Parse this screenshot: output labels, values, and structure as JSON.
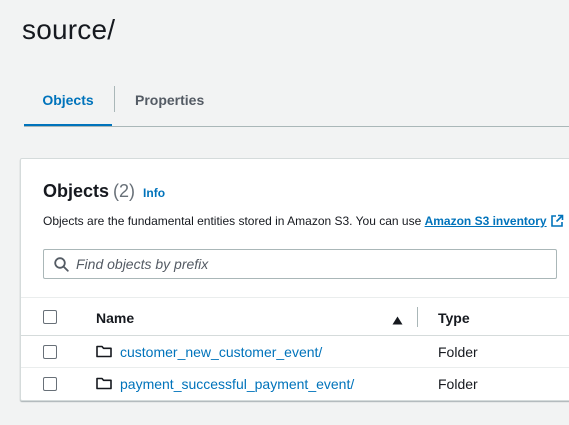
{
  "page": {
    "title": "source/"
  },
  "tabs": [
    {
      "label": "Objects",
      "active": true
    },
    {
      "label": "Properties",
      "active": false
    }
  ],
  "objects_panel": {
    "title": "Objects",
    "count": "(2)",
    "info_label": "Info",
    "description_prefix": "Objects are the fundamental entities stored in Amazon S3. You can use ",
    "description_link": "Amazon S3 inventory",
    "search": {
      "placeholder": "Find objects by prefix",
      "value": ""
    },
    "columns": {
      "name": "Name",
      "type": "Type"
    },
    "sort": "ascending",
    "rows": [
      {
        "name": "customer_new_customer_event/",
        "type": "Folder",
        "icon": "folder-icon"
      },
      {
        "name": "payment_successful_payment_event/",
        "type": "Folder",
        "icon": "folder-icon"
      }
    ]
  },
  "colors": {
    "accent": "#0073bb",
    "text": "#16191f",
    "background": "#f2f3f3",
    "panel": "#ffffff"
  }
}
